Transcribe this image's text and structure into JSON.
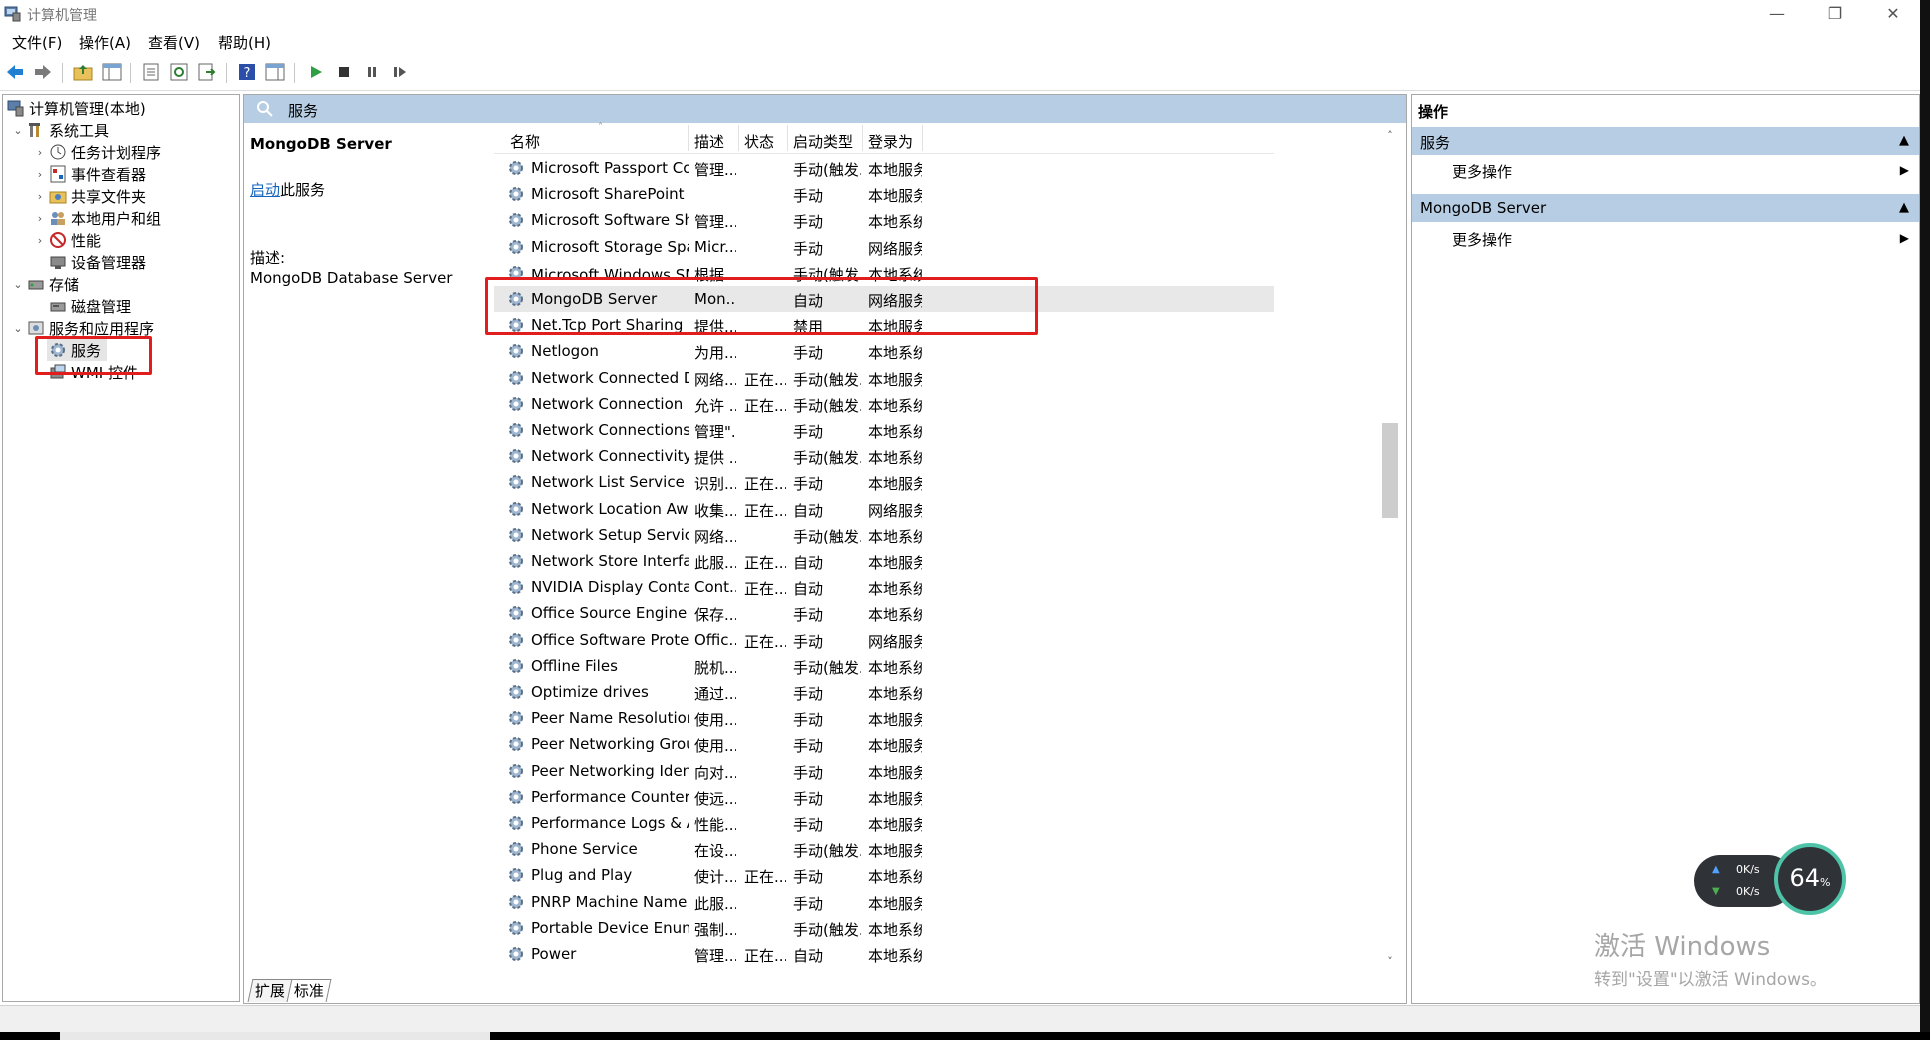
{
  "window": {
    "title": "计算机管理",
    "minimize": "—",
    "maximize": "❐",
    "close": "✕"
  },
  "menu": [
    "文件(F)",
    "操作(A)",
    "查看(V)",
    "帮助(H)"
  ],
  "tree": {
    "root": "计算机管理(本地)",
    "system_tools": "系统工具",
    "task_scheduler": "任务计划程序",
    "event_viewer": "事件查看器",
    "shared_folders": "共享文件夹",
    "local_users": "本地用户和组",
    "performance": "性能",
    "device_manager": "设备管理器",
    "storage": "存储",
    "disk_management": "磁盘管理",
    "services_apps": "服务和应用程序",
    "services": "服务",
    "wmi": "WMI 控件"
  },
  "center": {
    "header": "服务",
    "selected_name": "MongoDB Server",
    "start_link": "启动",
    "start_suffix": "此服务",
    "desc_label": "描述:",
    "desc_text": "MongoDB Database Server",
    "columns": [
      "名称",
      "描述",
      "状态",
      "启动类型",
      "登录为"
    ],
    "services": [
      [
        "Microsoft Passport Container",
        "管理...",
        "",
        "手动(触发...",
        "本地服务"
      ],
      [
        "Microsoft SharePoint Work...",
        "",
        "",
        "手动",
        "本地服务"
      ],
      [
        "Microsoft Software Shado...",
        "管理...",
        "",
        "手动",
        "本地系统"
      ],
      [
        "Microsoft Storage Spaces S...",
        "Micr...",
        "",
        "手动",
        "网络服务"
      ],
      [
        "Microsoft Windows SMS 路...",
        "根据...",
        "",
        "手动(触发...",
        "本地系统"
      ],
      [
        "MongoDB Server",
        "Mon...",
        "",
        "自动",
        "网络服务"
      ],
      [
        "Net.Tcp Port Sharing Service",
        "提供...",
        "",
        "禁用",
        "本地服务"
      ],
      [
        "Netlogon",
        "为用...",
        "",
        "手动",
        "本地系统"
      ],
      [
        "Network Connected Devic...",
        "网络...",
        "正在...",
        "手动(触发...",
        "本地服务"
      ],
      [
        "Network Connection Broker",
        "允许 ...",
        "正在...",
        "手动(触发...",
        "本地系统"
      ],
      [
        "Network Connections",
        "管理\"...",
        "",
        "手动",
        "本地系统"
      ],
      [
        "Network Connectivity Assis...",
        "提供 ...",
        "",
        "手动(触发...",
        "本地系统"
      ],
      [
        "Network List Service",
        "识别...",
        "正在...",
        "手动",
        "本地服务"
      ],
      [
        "Network Location Awarene...",
        "收集...",
        "正在...",
        "自动",
        "网络服务"
      ],
      [
        "Network Setup Service",
        "网络...",
        "",
        "手动(触发...",
        "本地系统"
      ],
      [
        "Network Store Interface Se...",
        "此服...",
        "正在...",
        "自动",
        "本地服务"
      ],
      [
        "NVIDIA Display Container LS",
        "Cont...",
        "正在...",
        "自动",
        "本地系统"
      ],
      [
        "Office  Source Engine",
        "保存...",
        "",
        "手动",
        "本地系统"
      ],
      [
        "Office Software Protection ...",
        "Offic...",
        "正在...",
        "手动",
        "网络服务"
      ],
      [
        "Offline Files",
        "脱机...",
        "",
        "手动(触发...",
        "本地系统"
      ],
      [
        "Optimize drives",
        "通过...",
        "",
        "手动",
        "本地系统"
      ],
      [
        "Peer Name Resolution Pro...",
        "使用...",
        "",
        "手动",
        "本地服务"
      ],
      [
        "Peer Networking Grouping",
        "使用...",
        "",
        "手动",
        "本地服务"
      ],
      [
        "Peer Networking Identity ...",
        "向对...",
        "",
        "手动",
        "本地服务"
      ],
      [
        "Performance Counter DLL ...",
        "使远...",
        "",
        "手动",
        "本地服务"
      ],
      [
        "Performance Logs & Alerts",
        "性能...",
        "",
        "手动",
        "本地服务"
      ],
      [
        "Phone Service",
        "在设...",
        "",
        "手动(触发...",
        "本地服务"
      ],
      [
        "Plug and Play",
        "使计...",
        "正在...",
        "手动",
        "本地系统"
      ],
      [
        "PNRP Machine Name Publ...",
        "此服...",
        "",
        "手动",
        "本地服务"
      ],
      [
        "Portable Device Enumerat...",
        "强制...",
        "",
        "手动(触发...",
        "本地系统"
      ],
      [
        "Power",
        "管理...",
        "正在...",
        "自动",
        "本地系统"
      ]
    ],
    "tabs": [
      "扩展",
      "标准"
    ]
  },
  "actions": {
    "title": "操作",
    "section1": "服务",
    "section1_item": "更多操作",
    "section2": "MongoDB Server",
    "section2_item": "更多操作"
  },
  "speed": {
    "up": "0K/s",
    "down": "0K/s",
    "percent": "64",
    "unit": "%"
  },
  "activation": {
    "line1": "激活 Windows",
    "line2": "转到\"设置\"以激活 Windows。"
  },
  "colors": {
    "header_bg": "#b6cde3",
    "highlight": "#e21d1d",
    "link": "#1565c0"
  }
}
